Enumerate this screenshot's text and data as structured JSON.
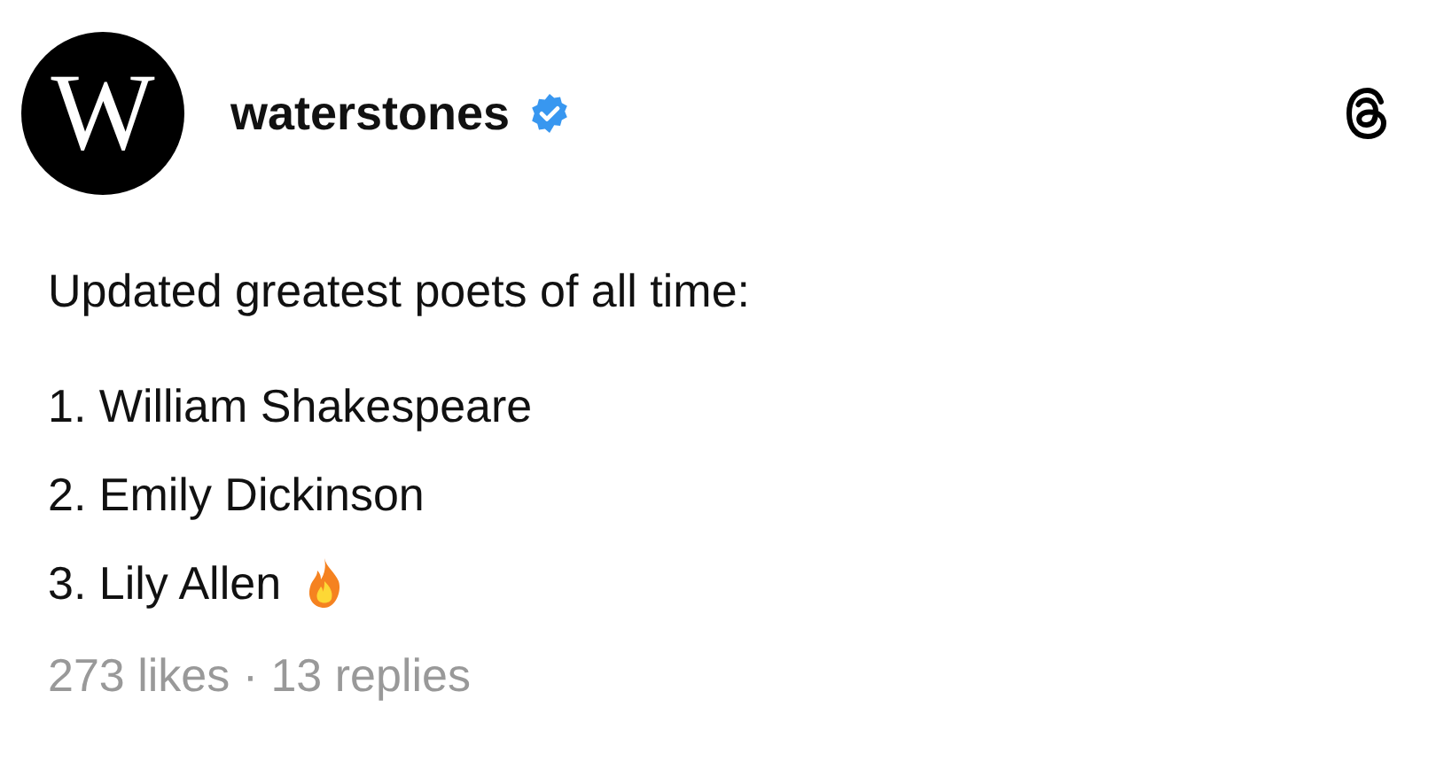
{
  "author": {
    "avatar_letter": "W",
    "name": "waterstones",
    "verified": true
  },
  "post": {
    "text": "Updated greatest poets of all time:",
    "list": [
      {
        "text": "1. William Shakespeare",
        "fire": false
      },
      {
        "text": "2. Emily Dickinson",
        "fire": false
      },
      {
        "text": "3. Lily Allen",
        "fire": true
      }
    ]
  },
  "stats": "273 likes · 13 replies"
}
